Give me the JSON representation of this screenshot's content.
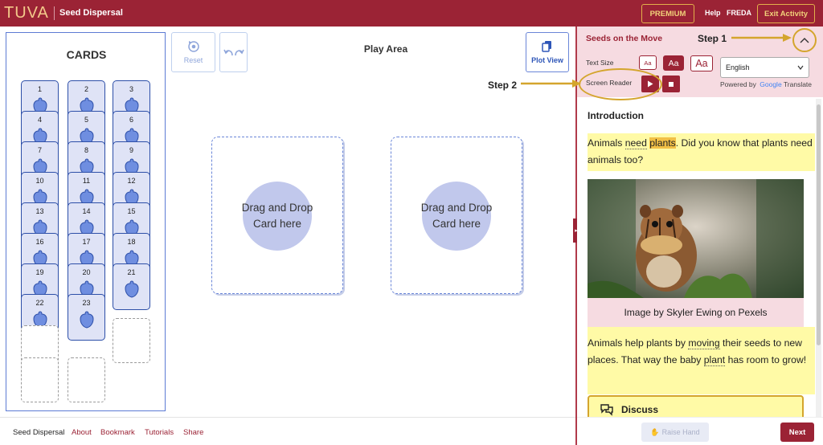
{
  "header": {
    "logo": "TUVA",
    "title": "Seed Dispersal",
    "premium_label": "PREMIUM",
    "help_label": "Help",
    "user_label": "FREDA",
    "exit_label": "Exit Activity"
  },
  "cards_panel": {
    "title": "CARDS",
    "cards": [
      "1",
      "2",
      "3",
      "4",
      "5",
      "6",
      "7",
      "8",
      "9",
      "10",
      "11",
      "12",
      "13",
      "14",
      "15",
      "16",
      "17",
      "18",
      "19",
      "20",
      "21",
      "22",
      "23"
    ]
  },
  "toolbar": {
    "reset_label": "Reset",
    "play_area_title": "Play Area",
    "plot_view_label": "Plot View"
  },
  "drop_zones": [
    {
      "line1": "Drag and Drop",
      "line2": "Card here"
    },
    {
      "line1": "Drag and Drop",
      "line2": "Card here"
    }
  ],
  "footer": {
    "items": [
      "Seed Dispersal",
      "About",
      "Bookmark",
      "Tutorials",
      "Share"
    ]
  },
  "side_panel": {
    "title": "Seeds on the Move",
    "text_size_label": "Text Size",
    "text_size_options": [
      "Aa",
      "Aa",
      "Aa"
    ],
    "language": "English",
    "powered_by": "Powered by",
    "translate_brand": "Google",
    "translate_label": "Translate",
    "screen_reader_label": "Screen Reader",
    "intro_heading": "Introduction",
    "para1_parts": [
      "Animals ",
      "need",
      " ",
      "plants",
      ". Did you know that plants need animals too?"
    ],
    "image_caption": "Image by Skyler Ewing on Pexels",
    "para2_parts": [
      "Animals help plants by ",
      "moving",
      " their seeds to new places. That way the baby ",
      "plant",
      " has room to grow!"
    ],
    "discuss_label": "Discuss",
    "raise_hand_label": "Raise Hand",
    "next_label": "Next"
  },
  "annotations": {
    "step1": "Step 1",
    "step2": "Step 2"
  },
  "colors": {
    "brand": "#9b2335",
    "accent_gold": "#d4a52d",
    "card_fill": "#dfe3f6",
    "card_border": "#2d4fa8",
    "highlight_yellow": "#fffaa6"
  }
}
